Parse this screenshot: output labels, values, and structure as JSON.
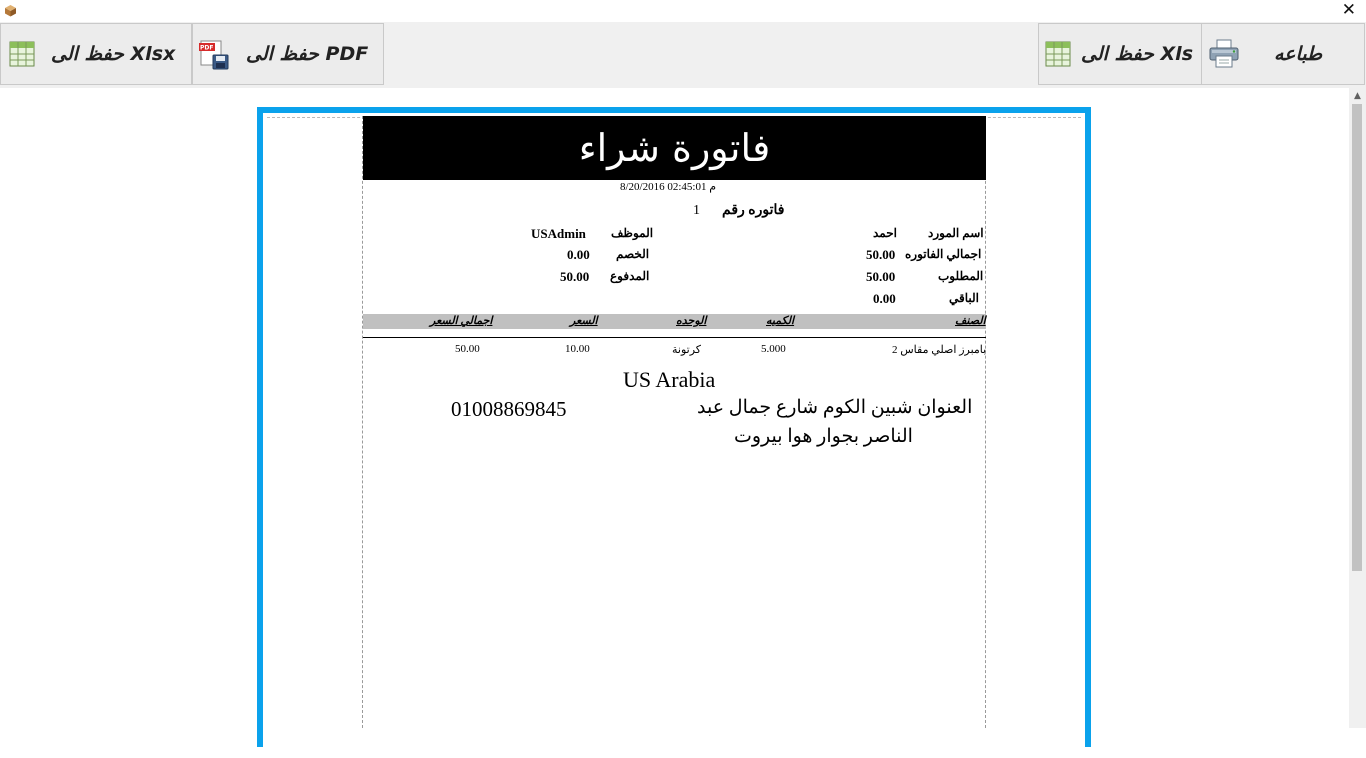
{
  "window": {
    "close_glyph": "✕",
    "app_icon": "box-icon"
  },
  "toolbar": {
    "print_label": "طباعه",
    "xls_label": "حفظ الى Xls",
    "pdf_label": "حفظ الى PDF",
    "xlsx_label": "حفظ الى Xlsx"
  },
  "invoice": {
    "title": "فاتورة شراء",
    "datetime": "8/20/2016 02:45:01 م",
    "number_label": "فاتوره رقم",
    "number_value": "1",
    "supplier_label": "اسم المورد",
    "supplier_value": "احمد",
    "employee_label": "الموظف",
    "employee_value": "USAdmin",
    "total_label": "اجمالي الفاتوره",
    "total_value": "50.00",
    "discount_label": "الخصم",
    "discount_value": "0.00",
    "required_label": "المطلوب",
    "required_value": "50.00",
    "paid_label": "المدفوع",
    "paid_value": "50.00",
    "remaining_label": "الباقي",
    "remaining_value": "0.00",
    "columns": {
      "item": "الصنف",
      "quantity": "الكميه",
      "unit": "الوحده",
      "price": "السعر",
      "line_total": "اجمالي السعر"
    },
    "rows": [
      {
        "item": "بامبرز اصلي مقاس 2",
        "quantity": "5.000",
        "unit": "كرتونة",
        "price": "10.00",
        "line_total": "50.00"
      }
    ],
    "company": "US Arabia",
    "address_line1": "العنوان شبين الكوم شارع جمال عبد",
    "address_line2": "الناصر بجوار هوا بيروت",
    "phone": "01008869845"
  },
  "colors": {
    "frame": "#0aa2ec",
    "title_band": "#000000",
    "header_band": "#c0c0c0"
  }
}
